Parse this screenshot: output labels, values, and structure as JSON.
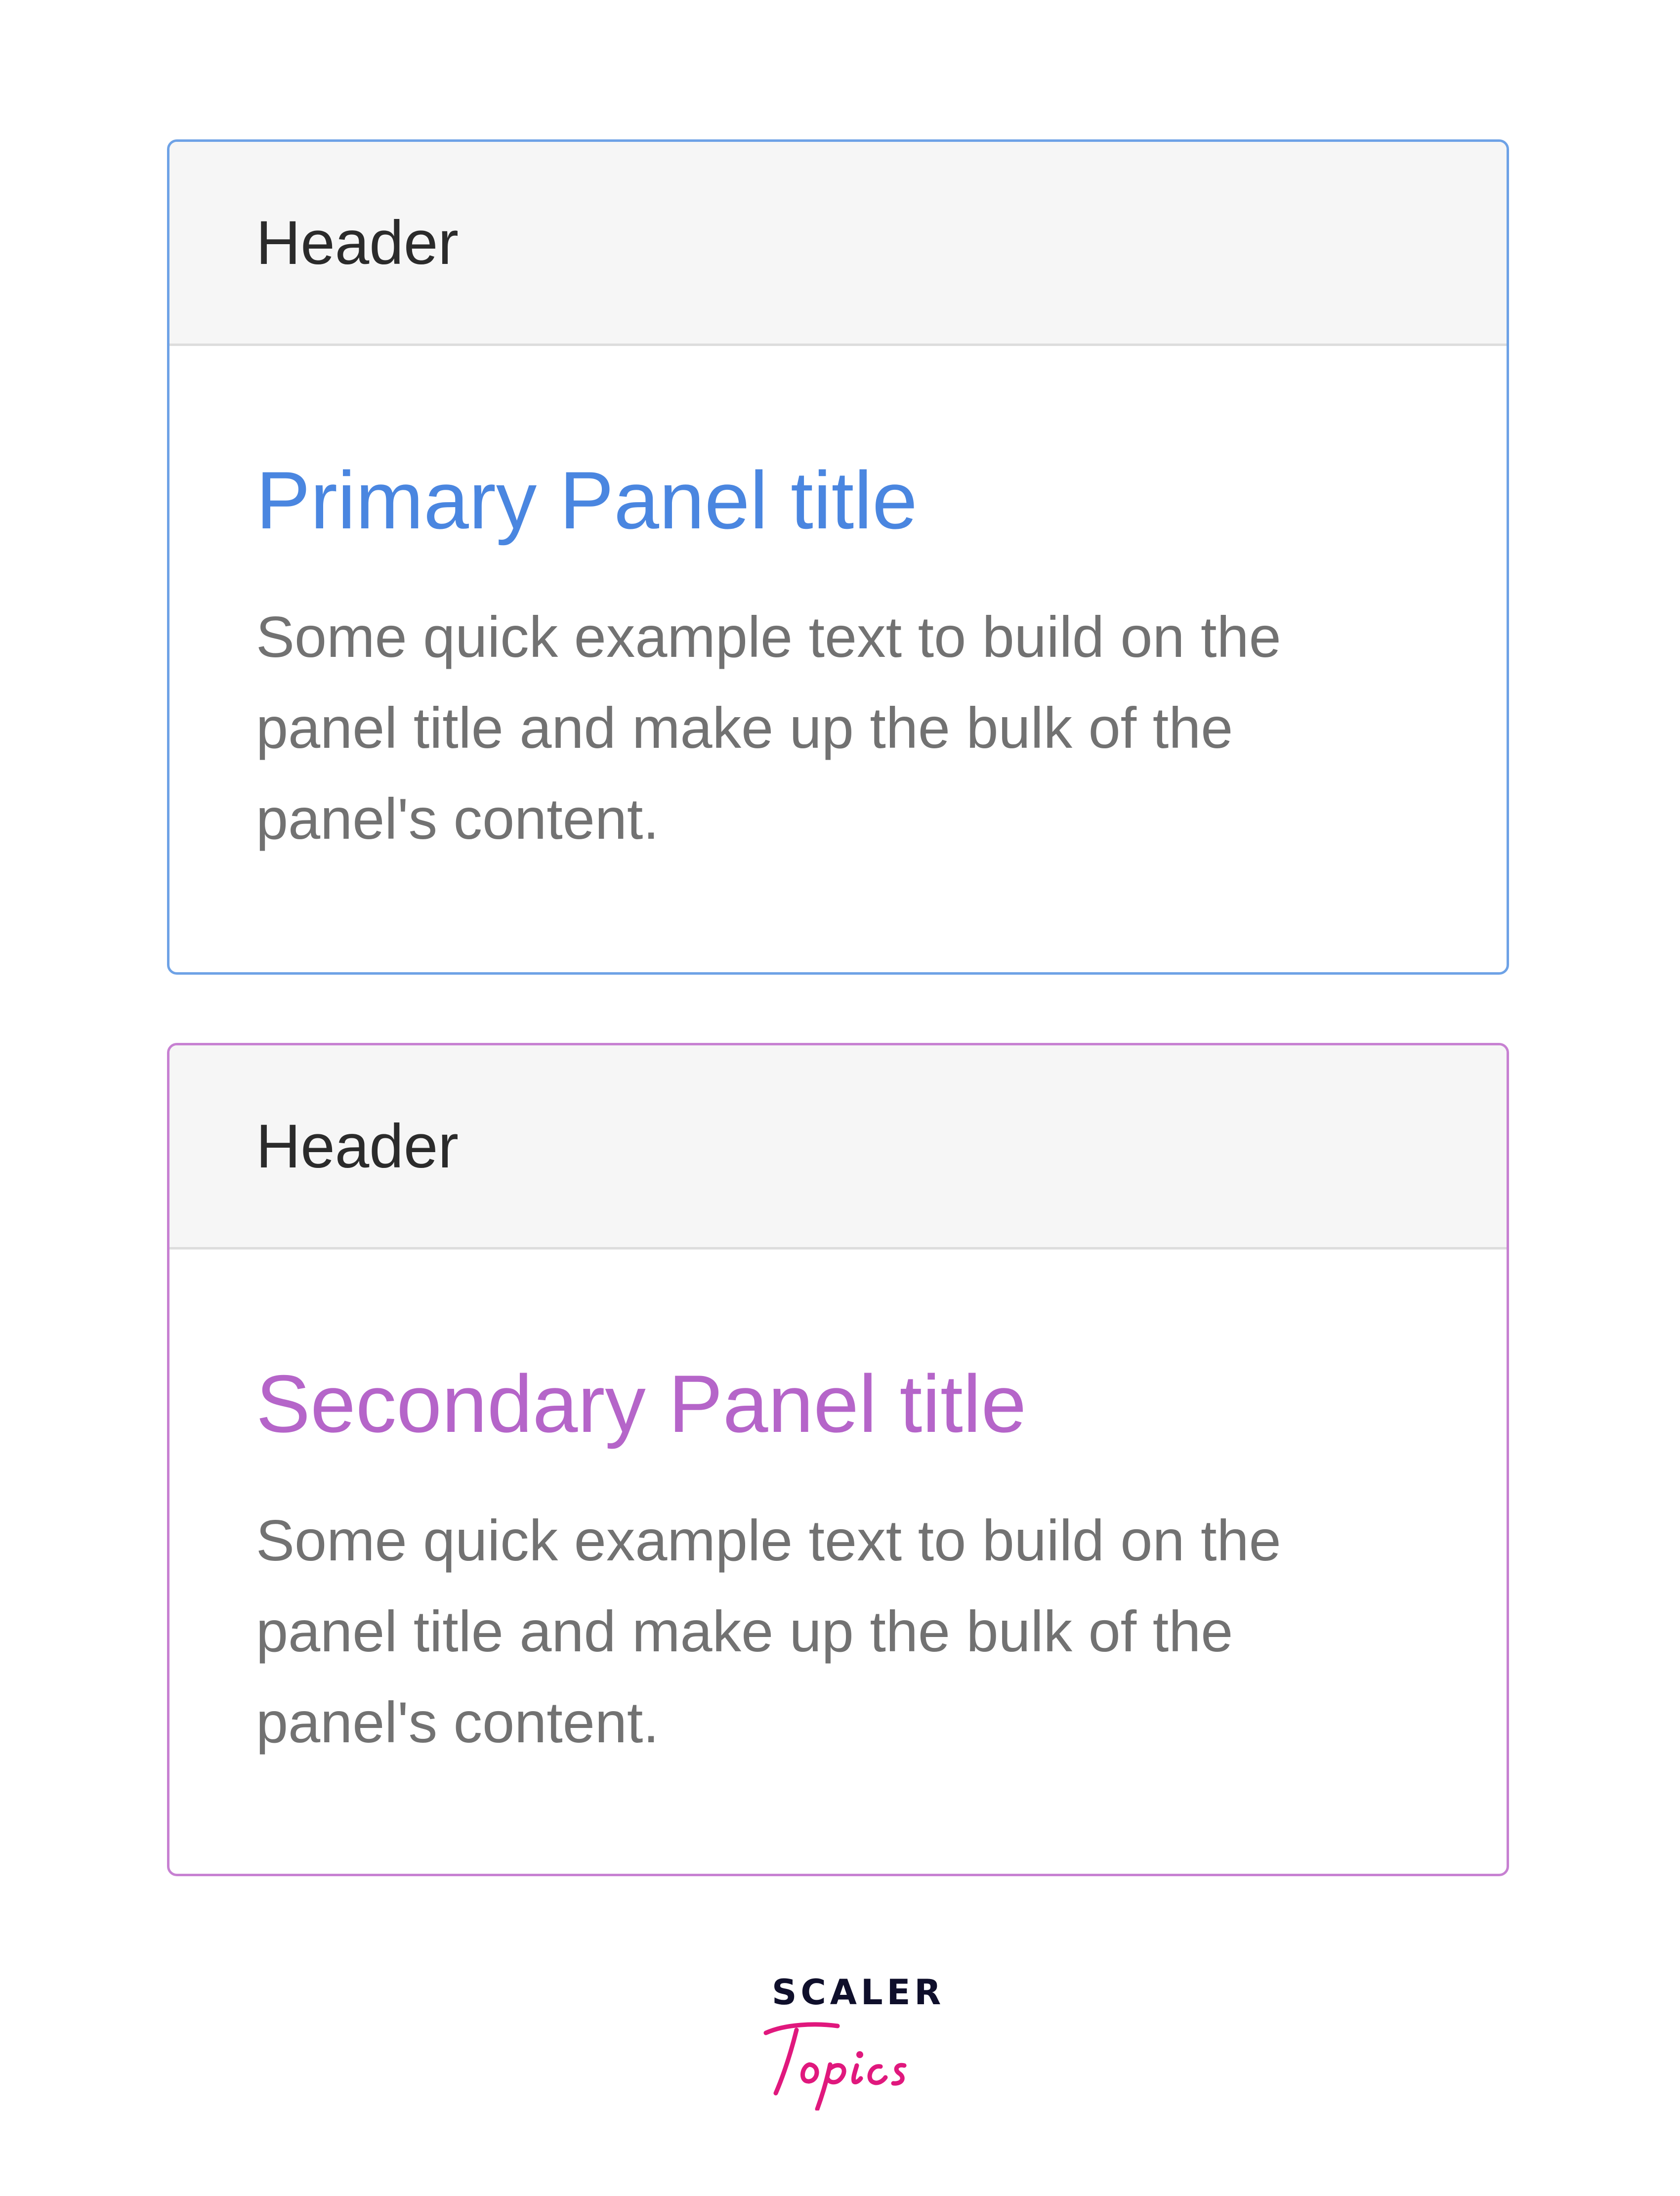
{
  "panels": [
    {
      "header": "Header",
      "title": "Primary Panel title",
      "text": "Some quick example text to build on the panel title and make up the bulk of the panel's content.",
      "border_color": "#6ea2e6",
      "title_color": "#4a86e0"
    },
    {
      "header": "Header",
      "title": "Secondary Panel title",
      "text": "Some quick example text to build on the panel title and make up the bulk of the panel's content.",
      "border_color": "#c781d2",
      "title_color": "#b565c9"
    }
  ],
  "logo": {
    "top_text": "SCALER",
    "script_text": "Topics",
    "top_color": "#0f0f2b",
    "script_color": "#e0187d"
  }
}
